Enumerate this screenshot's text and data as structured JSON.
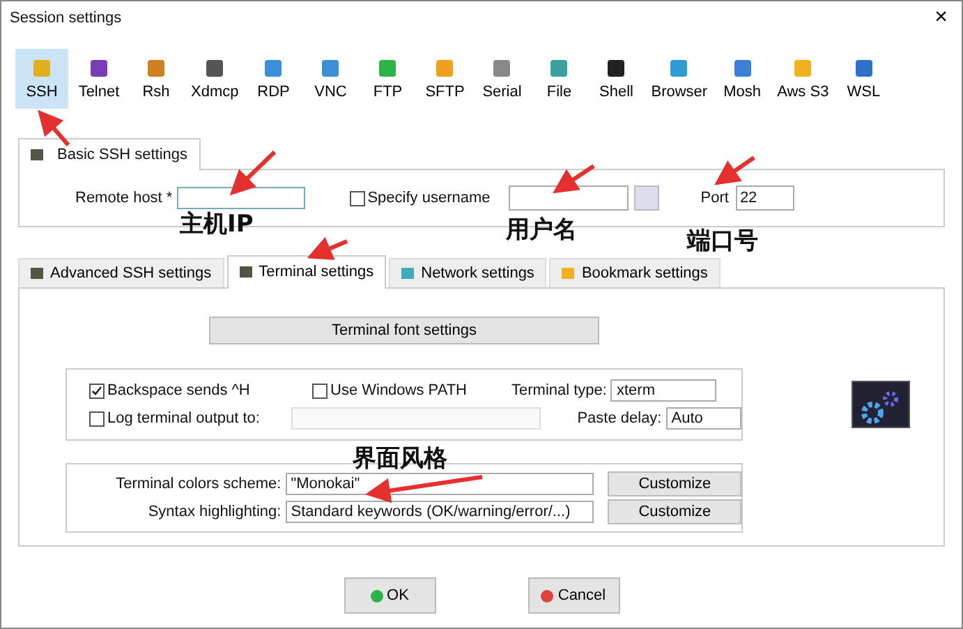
{
  "window": {
    "title": "Session settings",
    "close": "×"
  },
  "session_types": [
    {
      "label": "SSH",
      "selected": true
    },
    {
      "label": "Telnet",
      "selected": false
    },
    {
      "label": "Rsh",
      "selected": false
    },
    {
      "label": "Xdmcp",
      "selected": false
    },
    {
      "label": "RDP",
      "selected": false
    },
    {
      "label": "VNC",
      "selected": false
    },
    {
      "label": "FTP",
      "selected": false
    },
    {
      "label": "SFTP",
      "selected": false
    },
    {
      "label": "Serial",
      "selected": false
    },
    {
      "label": "File",
      "selected": false
    },
    {
      "label": "Shell",
      "selected": false
    },
    {
      "label": "Browser",
      "selected": false
    },
    {
      "label": "Mosh",
      "selected": false
    },
    {
      "label": "Aws S3",
      "selected": false
    },
    {
      "label": "WSL",
      "selected": false
    }
  ],
  "basic_tab": {
    "label": "Basic SSH settings"
  },
  "basic": {
    "remote_host_label": "Remote host *",
    "specify_username": {
      "label": "Specify username",
      "checked": false
    },
    "port_label": "Port",
    "port_value": "22"
  },
  "tabs": [
    {
      "label": "Advanced SSH settings",
      "selected": false
    },
    {
      "label": "Terminal settings",
      "selected": true
    },
    {
      "label": "Network settings",
      "selected": false
    },
    {
      "label": "Bookmark settings",
      "selected": false
    }
  ],
  "terminal": {
    "font_button": "Terminal font settings",
    "checkboxes": [
      {
        "label": "Backspace sends ^H",
        "checked": true
      },
      {
        "label": "Use Windows PATH",
        "checked": false
      },
      {
        "label": "Log terminal output to:",
        "checked": false
      }
    ],
    "terminal_type_label": "Terminal type:",
    "terminal_type": "xterm",
    "paste_delay_label": "Paste delay:",
    "paste_delay": "Auto",
    "colors_label": "Terminal colors scheme:",
    "colors_value": "\"Monokai\"",
    "syntax_label": "Syntax highlighting:",
    "syntax_value": "Standard keywords (OK/warning/error/...)",
    "customize": [
      "Customize",
      "Customize"
    ]
  },
  "buttons": [
    {
      "label": "OK",
      "kind": "ok"
    },
    {
      "label": "Cancel",
      "kind": "cancel"
    }
  ],
  "annotations": [
    {
      "text": "主机IP"
    },
    {
      "text": "用户名"
    },
    {
      "text": "端口号"
    },
    {
      "text": "界面风格"
    }
  ]
}
